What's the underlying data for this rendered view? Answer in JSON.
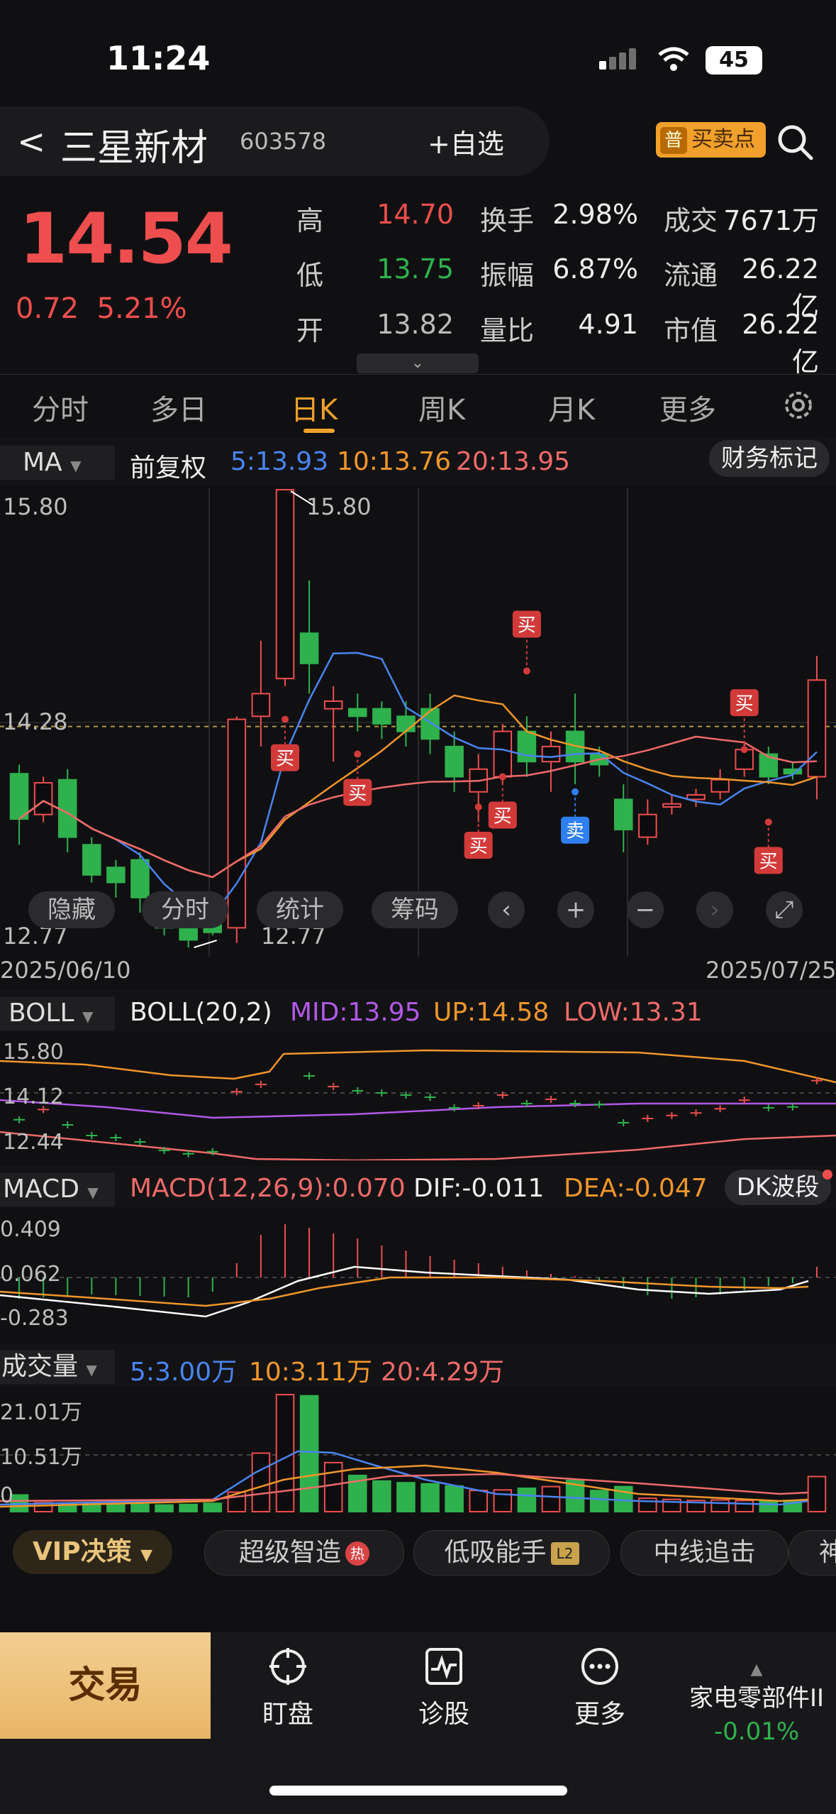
{
  "status": {
    "time": "11:24",
    "battery": "45"
  },
  "header": {
    "back": "<",
    "name": "三星新材",
    "code": "603578",
    "add_watch": "+自选",
    "buy_sell_badge": "普",
    "buy_sell": "买卖点"
  },
  "quote": {
    "price": "14.54",
    "change": "0.72",
    "change_pct": "5.21%",
    "rows": [
      {
        "l1": "高",
        "v1": "14.70",
        "l2": "换手",
        "v2": "2.98%",
        "l3": "成交",
        "v3": "7671万"
      },
      {
        "l1": "低",
        "v1": "13.75",
        "l2": "振幅",
        "v2": "6.87%",
        "l3": "流通",
        "v3": "26.22亿"
      },
      {
        "l1": "开",
        "v1": "13.82",
        "l2": "量比",
        "v2": "4.91",
        "l3": "市值",
        "v3": "26.22亿"
      }
    ],
    "expand": "⌄"
  },
  "tabs": [
    "分时",
    "多日",
    "日K",
    "周K",
    "月K",
    "更多"
  ],
  "active_tab": "日K",
  "ma_bar": {
    "selector": "MA",
    "adjust": "前复权",
    "ma5": "5:13.93",
    "ma10": "10:13.76",
    "ma20": "20:13.95",
    "finance_mark": "财务标记"
  },
  "colors": {
    "up": "#ef4e4e",
    "down": "#2fb14d",
    "ma5": "#4a84f0",
    "ma10": "#f0962b",
    "ma20": "#ef6a6a",
    "mid": "#b159e6"
  },
  "kchart": {
    "ytop": "15.80",
    "ymid": "14.28",
    "ybot": "12.77",
    "hi_label": "15.80",
    "lo_label": "12.77",
    "date_start": "2025/06/10",
    "date_end": "2025/07/25",
    "buy": "买",
    "sell": "卖",
    "controls": {
      "hide": "隐藏",
      "fenshi": "分时",
      "stats": "统计",
      "chips": "筹码"
    }
  },
  "boll": {
    "selector": "BOLL",
    "param": "BOLL(20,2)",
    "mid": "MID:13.95",
    "up": "UP:14.58",
    "low": "LOW:13.31",
    "ytop": "15.80",
    "ymid": "14.12",
    "ybot": "12.44"
  },
  "macd": {
    "selector": "MACD",
    "param": "MACD(12,26,9):0.070",
    "dif": "DIF:-0.011",
    "dea": "DEA:-0.047",
    "dk": "DK波段",
    "ytop": "0.409",
    "ymid": "0.062",
    "ybot": "-0.283"
  },
  "volume": {
    "selector": "成交量",
    "ma5": "5:3.00万",
    "ma10": "10:3.11万",
    "ma20": "20:4.29万",
    "ytop": "21.01万",
    "ymid": "10.51万",
    "ybot": "0"
  },
  "chart_data": {
    "type": "candlestick",
    "dates": [
      "2025/06/10",
      "2025/07/25"
    ],
    "candles": [
      {
        "o": 13.92,
        "c": 13.62,
        "h": 13.98,
        "l": 13.45
      },
      {
        "o": 13.65,
        "c": 13.86,
        "h": 13.9,
        "l": 13.6
      },
      {
        "o": 13.88,
        "c": 13.5,
        "h": 13.95,
        "l": 13.4
      },
      {
        "o": 13.45,
        "c": 13.25,
        "h": 13.5,
        "l": 13.2
      },
      {
        "o": 13.3,
        "c": 13.2,
        "h": 13.35,
        "l": 13.1
      },
      {
        "o": 13.35,
        "c": 13.1,
        "h": 13.4,
        "l": 13.0
      },
      {
        "o": 13.0,
        "c": 12.9,
        "h": 13.05,
        "l": 12.85
      },
      {
        "o": 12.95,
        "c": 12.82,
        "h": 13.0,
        "l": 12.77
      },
      {
        "o": 13.0,
        "c": 12.87,
        "h": 13.1,
        "l": 12.85
      },
      {
        "o": 12.9,
        "c": 14.28,
        "h": 14.3,
        "l": 12.8
      },
      {
        "o": 14.3,
        "c": 14.45,
        "h": 14.8,
        "l": 14.1
      },
      {
        "o": 14.55,
        "c": 15.8,
        "h": 15.8,
        "l": 14.5
      },
      {
        "o": 14.85,
        "c": 14.65,
        "h": 15.2,
        "l": 14.45
      },
      {
        "o": 14.35,
        "c": 14.4,
        "h": 14.5,
        "l": 14.0
      },
      {
        "o": 14.35,
        "c": 14.3,
        "h": 14.45,
        "l": 14.2
      },
      {
        "o": 14.35,
        "c": 14.25,
        "h": 14.4,
        "l": 14.15
      },
      {
        "o": 14.3,
        "c": 14.2,
        "h": 14.4,
        "l": 14.1
      },
      {
        "o": 14.35,
        "c": 14.15,
        "h": 14.45,
        "l": 14.05
      },
      {
        "o": 14.1,
        "c": 13.9,
        "h": 14.2,
        "l": 13.8
      },
      {
        "o": 13.8,
        "c": 13.95,
        "h": 14.05,
        "l": 13.6
      },
      {
        "o": 13.9,
        "c": 14.2,
        "h": 14.25,
        "l": 13.85
      },
      {
        "o": 14.2,
        "c": 14.0,
        "h": 14.3,
        "l": 13.9
      },
      {
        "o": 14.0,
        "c": 14.1,
        "h": 14.2,
        "l": 13.8
      },
      {
        "o": 14.2,
        "c": 14.0,
        "h": 14.45,
        "l": 13.85
      },
      {
        "o": 14.05,
        "c": 13.98,
        "h": 14.1,
        "l": 13.9
      },
      {
        "o": 13.75,
        "c": 13.55,
        "h": 13.85,
        "l": 13.4
      },
      {
        "o": 13.5,
        "c": 13.65,
        "h": 13.75,
        "l": 13.45
      },
      {
        "o": 13.7,
        "c": 13.72,
        "h": 13.78,
        "l": 13.65
      },
      {
        "o": 13.75,
        "c": 13.78,
        "h": 13.82,
        "l": 13.7
      },
      {
        "o": 13.8,
        "c": 13.88,
        "h": 13.95,
        "l": 13.75
      },
      {
        "o": 13.95,
        "c": 14.08,
        "h": 14.12,
        "l": 13.9
      },
      {
        "o": 14.05,
        "c": 13.9,
        "h": 14.1,
        "l": 13.85
      },
      {
        "o": 13.95,
        "c": 13.92,
        "h": 14.0,
        "l": 13.88
      },
      {
        "o": 13.9,
        "c": 14.54,
        "h": 14.7,
        "l": 13.75
      }
    ]
  },
  "vip": {
    "label": "VIP决策",
    "chips": [
      "超级智造",
      "低吸能手",
      "中线追击",
      "神"
    ],
    "hot": "热",
    "l2": "L2"
  },
  "bottom": {
    "trade": "交易",
    "nav": [
      "盯盘",
      "诊股",
      "更多"
    ],
    "sector": "家电零部件II",
    "sector_chg": "-0.01%"
  }
}
